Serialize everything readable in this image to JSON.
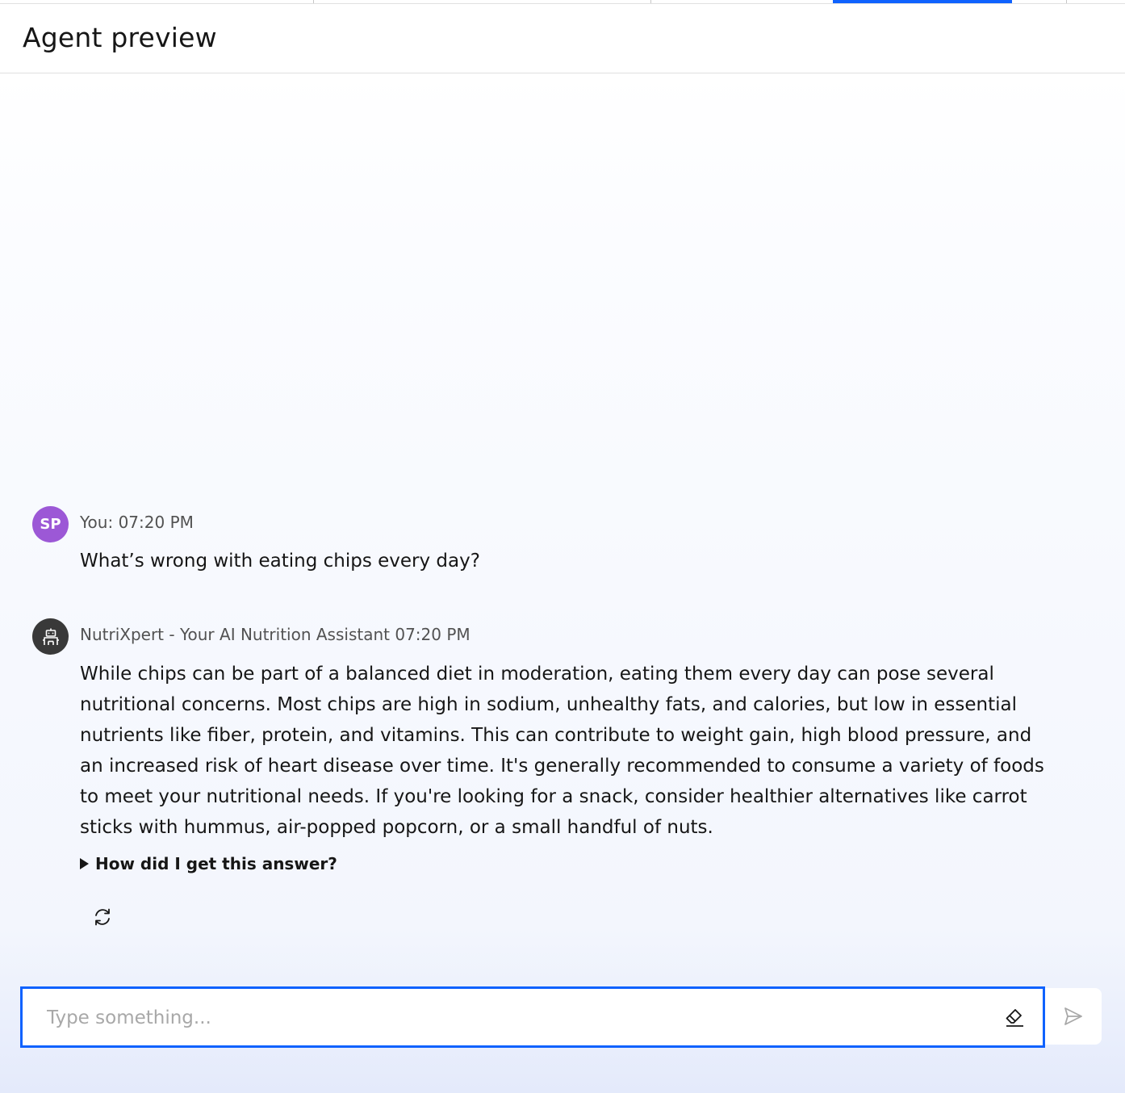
{
  "header": {
    "title": "Agent preview"
  },
  "messages": [
    {
      "sender": "user",
      "avatar_initials": "SP",
      "meta": "You: 07:20 PM",
      "text": "What’s wrong with eating chips every day?"
    },
    {
      "sender": "agent",
      "avatar_icon": "robot-icon",
      "meta": "NutriXpert - Your AI Nutrition Assistant 07:20 PM",
      "text": "While chips can be part of a balanced diet in moderation, eating them every day can pose several nutritional concerns. Most chips are high in sodium, unhealthy fats, and calories, but low in essential nutrients like fiber, protein, and vitamins. This can contribute to weight gain, high blood pressure, and an increased risk of heart disease over time. It's generally recommended to consume a variety of foods to meet your nutritional needs. If you're looking for a snack, consider healthier alternatives like carrot sticks with hummus, air-popped popcorn, or a small handful of nuts.",
      "disclosure_label": "How did I get this answer?",
      "action_icon": "regenerate-icon"
    }
  ],
  "composer": {
    "placeholder": "Type something...",
    "clear_icon": "eraser-icon",
    "send_icon": "send-icon"
  },
  "colors": {
    "accent": "#0f62fe",
    "user_avatar": "#9c58d6",
    "agent_avatar": "#393939"
  }
}
